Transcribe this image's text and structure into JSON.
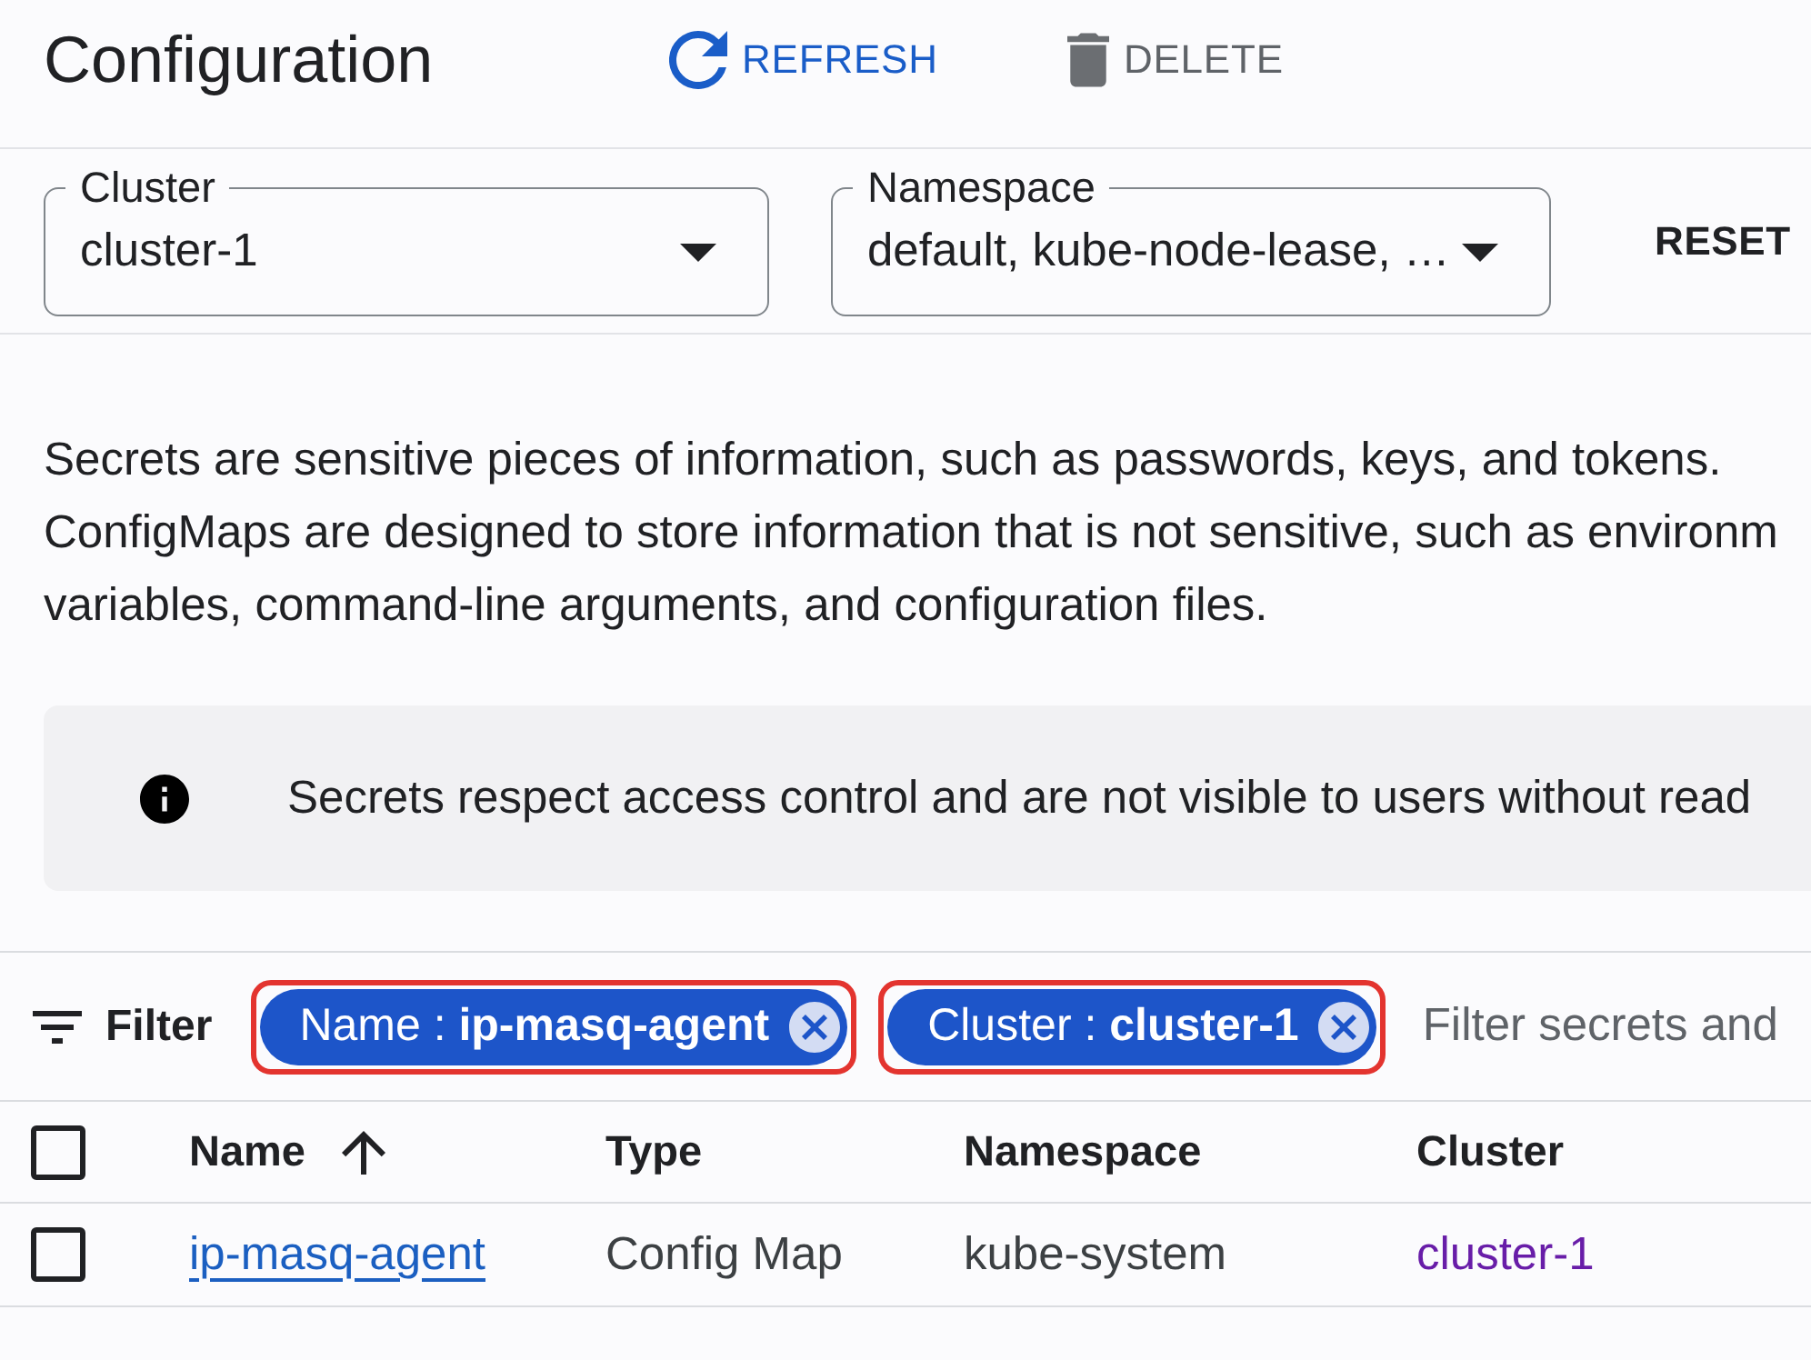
{
  "header": {
    "title": "Configuration",
    "actions": [
      {
        "kind": "refresh",
        "label": "REFRESH",
        "disabled": false
      },
      {
        "kind": "delete",
        "label": "DELETE",
        "disabled": true
      }
    ]
  },
  "selectors": {
    "fields": [
      {
        "label": "Cluster",
        "value": "cluster-1"
      },
      {
        "label": "Namespace",
        "value": "default, kube-node-lease, …"
      }
    ],
    "reset": "RESET"
  },
  "description": "Secrets are sensitive pieces of information, such as passwords, keys, and tokens.\nConfigMaps are designed to store information that is not sensitive, such as environm\nvariables, command-line arguments, and configuration files.",
  "notice": {
    "text": "Secrets respect access control and are not visible to users without read"
  },
  "filter_bar": {
    "label": "Filter",
    "chips": [
      {
        "text": "Name : **ip-masq-agent**",
        "highlighted": true
      },
      {
        "text": "Cluster : **cluster-1**",
        "highlighted": true
      }
    ],
    "placeholder": "Filter secrets and"
  },
  "table": {
    "select_all_checked": false,
    "columns": [
      {
        "label": "Name",
        "sorted_ascending": true
      },
      {
        "label": "Type",
        "sorted_ascending": false
      },
      {
        "label": "Namespace",
        "sorted_ascending": false
      },
      {
        "label": "Cluster",
        "sorted_ascending": false
      }
    ],
    "rows": [
      {
        "checked": false,
        "cells": [
          {
            "kind": "link",
            "text": "ip-masq-agent"
          },
          {
            "kind": "text",
            "text": "Config Map"
          },
          {
            "kind": "text",
            "text": "kube-system"
          },
          {
            "kind": "visited-link",
            "text": "cluster-1"
          }
        ]
      }
    ]
  }
}
